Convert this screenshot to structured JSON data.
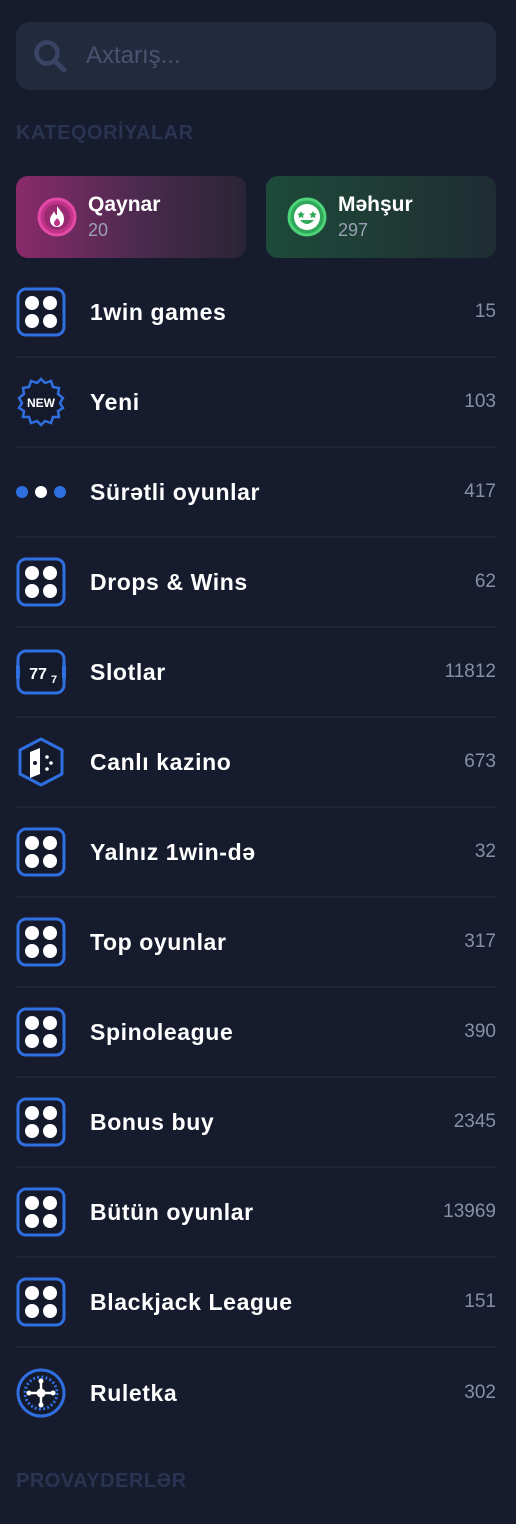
{
  "search": {
    "placeholder": "Axtarış..."
  },
  "sections": {
    "categories": "KATEQORİYALAR",
    "providers": "PROVAYDERLƏR"
  },
  "cards": [
    {
      "title": "Qaynar",
      "count": "20",
      "icon": "fire-icon"
    },
    {
      "title": "Məhşur",
      "count": "297",
      "icon": "star-eyes-smiley-icon"
    }
  ],
  "items": [
    {
      "label": "1win games",
      "count": "15",
      "icon": "grid-dots-icon"
    },
    {
      "label": "Yeni",
      "count": "103",
      "icon": "new-badge-icon"
    },
    {
      "label": "Sürətli oyunlar",
      "count": "417",
      "icon": "three-dots-icon"
    },
    {
      "label": "Drops & Wins",
      "count": "62",
      "icon": "grid-dots-icon"
    },
    {
      "label": "Slotlar",
      "count": "11812",
      "icon": "slot-777-icon"
    },
    {
      "label": "Canlı kazino",
      "count": "673",
      "icon": "dice-card-icon"
    },
    {
      "label": "Yalnız 1win-də",
      "count": "32",
      "icon": "grid-dots-icon"
    },
    {
      "label": "Top oyunlar",
      "count": "317",
      "icon": "grid-dots-icon"
    },
    {
      "label": "Spinoleague",
      "count": "390",
      "icon": "grid-dots-icon"
    },
    {
      "label": "Bonus buy",
      "count": "2345",
      "icon": "grid-dots-icon"
    },
    {
      "label": "Bütün oyunlar",
      "count": "13969",
      "icon": "grid-dots-icon"
    },
    {
      "label": "Blackjack League",
      "count": "151",
      "icon": "grid-dots-icon"
    },
    {
      "label": "Ruletka",
      "count": "302",
      "icon": "roulette-icon"
    }
  ],
  "colors": {
    "background": "#161c2e",
    "accent": "#2f6fe0",
    "count": "#8590a8"
  }
}
